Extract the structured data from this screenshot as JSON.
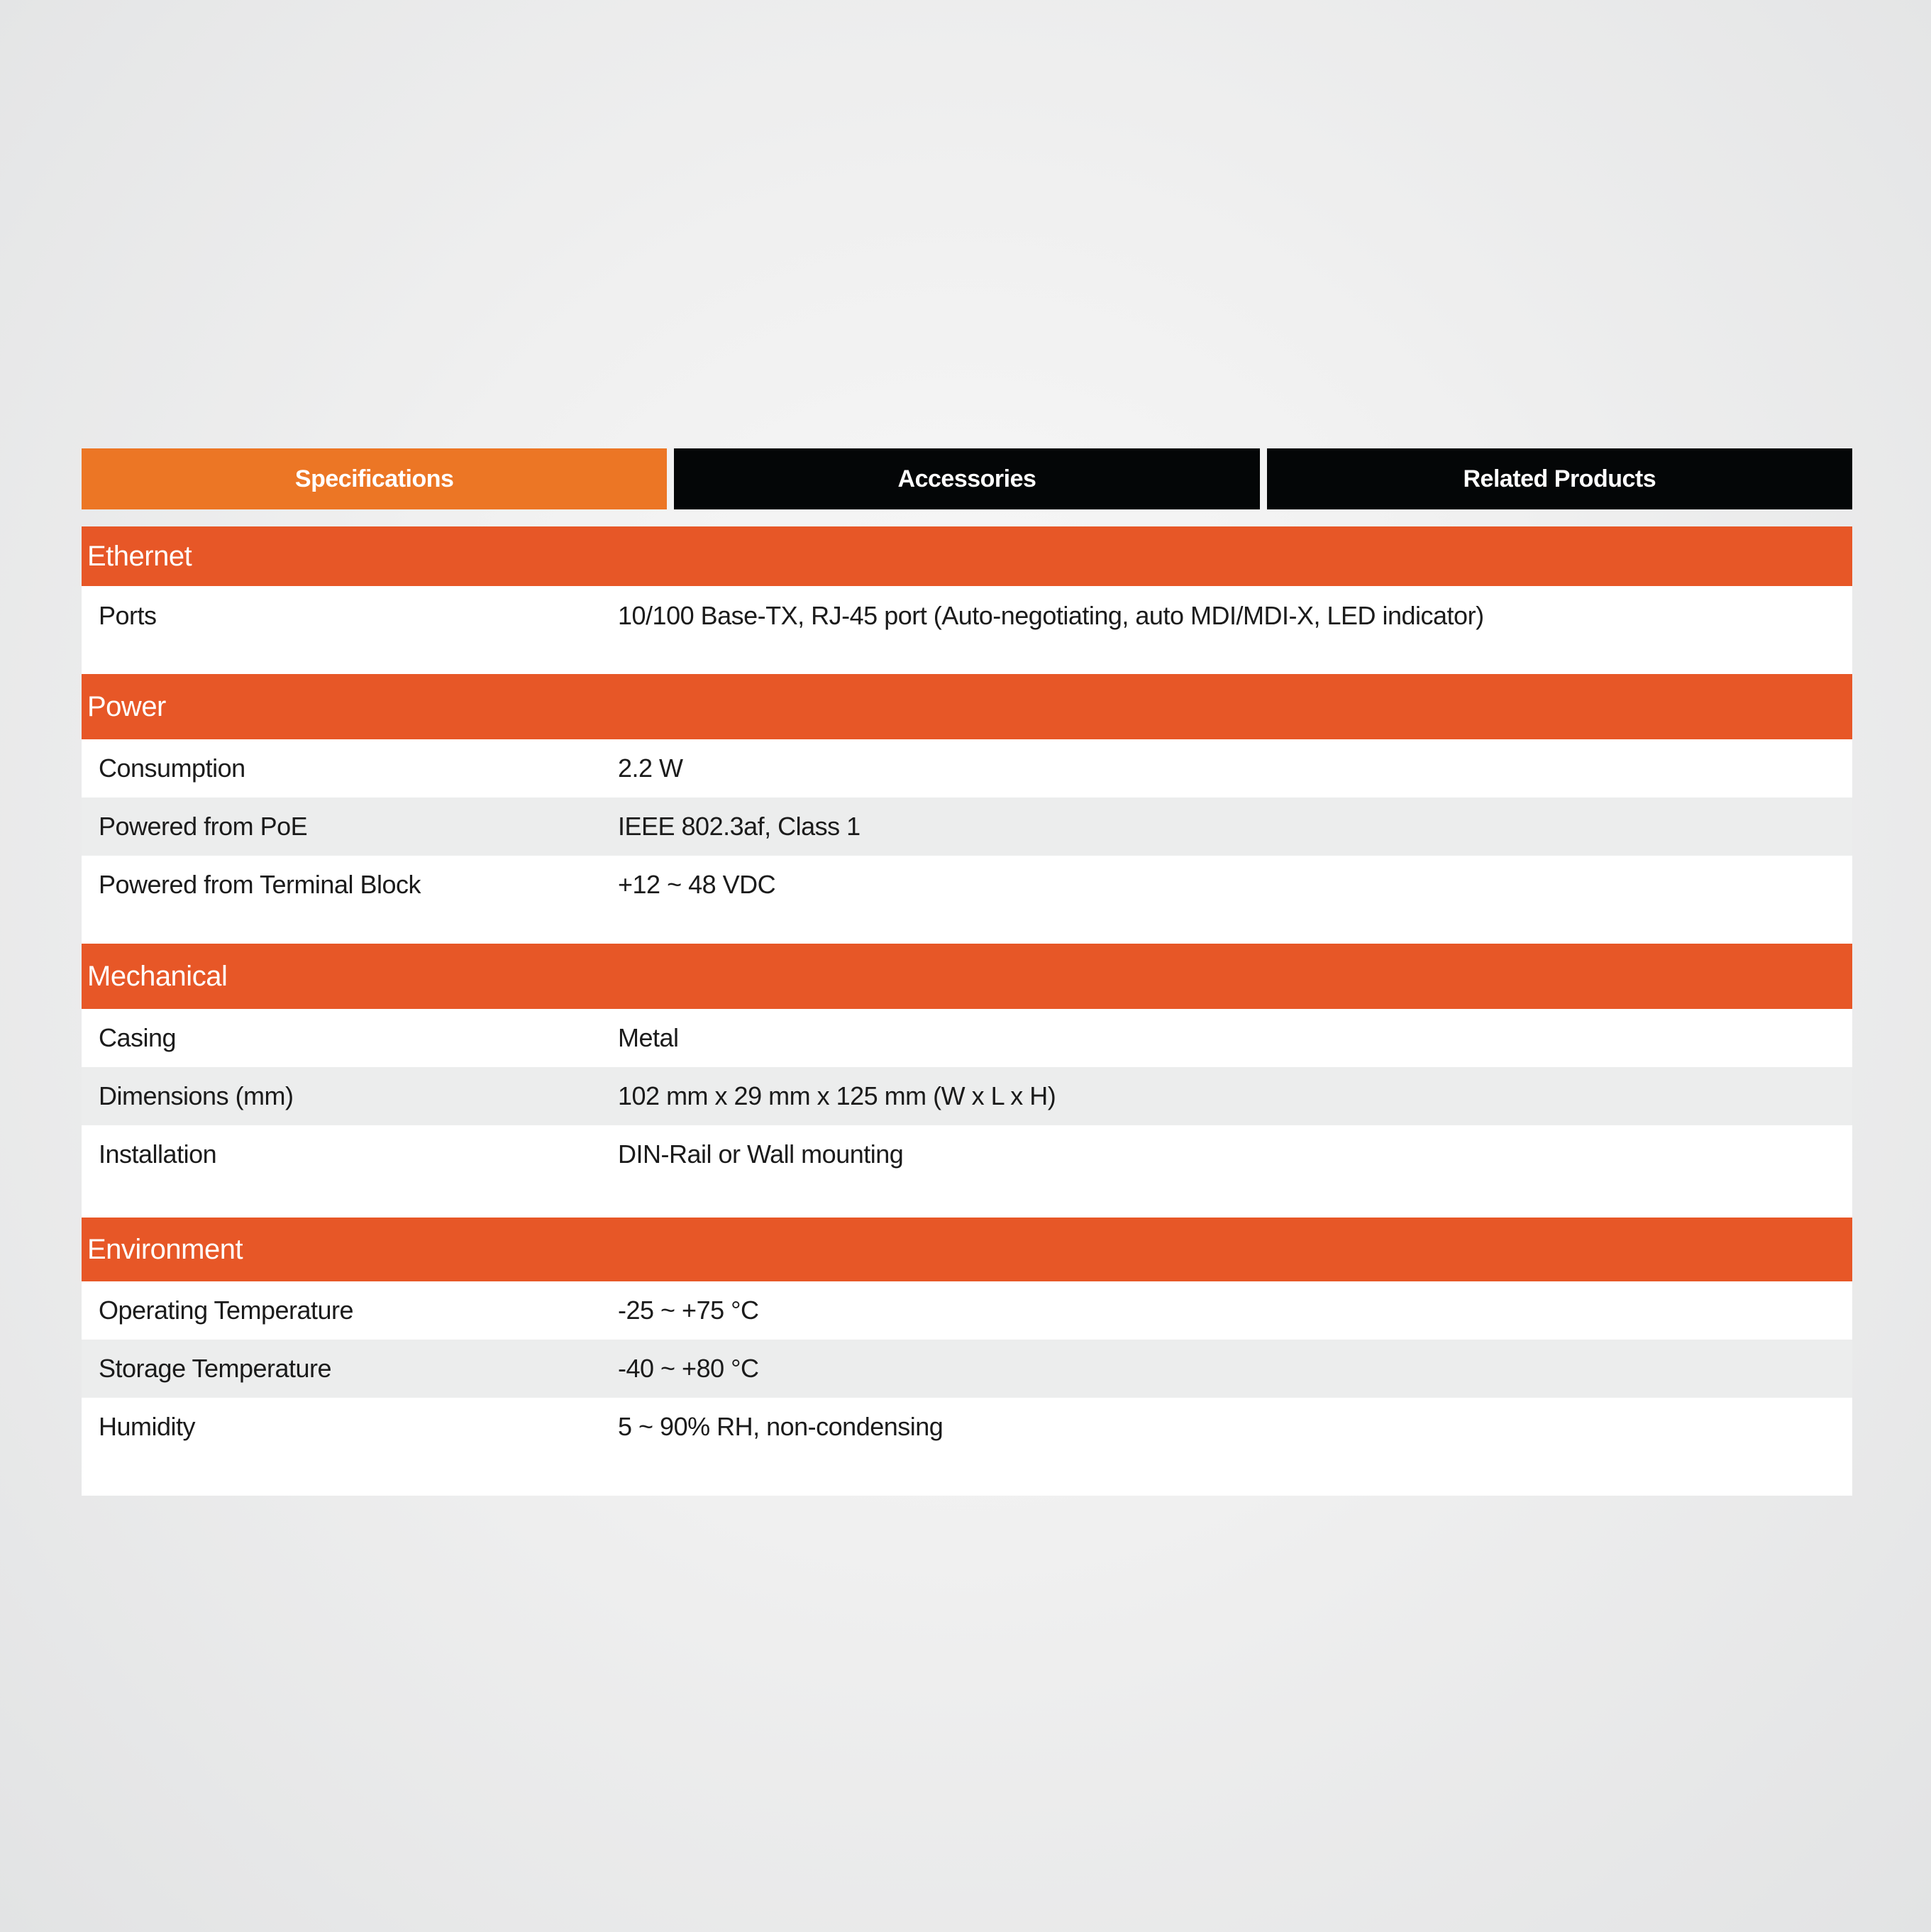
{
  "tabs": [
    {
      "label": "Specifications",
      "active": true
    },
    {
      "label": "Accessories",
      "active": false
    },
    {
      "label": "Related Products",
      "active": false
    }
  ],
  "colors": {
    "active_tab": "#ec7625",
    "inactive_tab": "#040607",
    "section_header": "#e75727",
    "alt_row": "#eceded"
  },
  "sections": [
    {
      "title": "Ethernet",
      "rows": [
        {
          "label": "Ports",
          "value": "10/100 Base-TX, RJ-45 port (Auto-negotiating, auto MDI/MDI-X, LED indicator)"
        }
      ]
    },
    {
      "title": "Power",
      "rows": [
        {
          "label": "Consumption",
          "value": "2.2 W"
        },
        {
          "label": "Powered from PoE",
          "value": "IEEE 802.3af, Class 1"
        },
        {
          "label": "Powered from Terminal Block",
          "value": "+12 ~ 48 VDC"
        }
      ]
    },
    {
      "title": "Mechanical",
      "rows": [
        {
          "label": "Casing",
          "value": "Metal"
        },
        {
          "label": "Dimensions (mm)",
          "value": "102 mm x 29 mm x 125 mm (W x L x H)"
        },
        {
          "label": "Installation",
          "value": "DIN-Rail or Wall mounting"
        }
      ]
    },
    {
      "title": "Environment",
      "rows": [
        {
          "label": "Operating Temperature",
          "value": "-25 ~ +75 °C"
        },
        {
          "label": "Storage Temperature",
          "value": "-40 ~ +80 °C"
        },
        {
          "label": "Humidity",
          "value": "5 ~ 90% RH, non-condensing"
        }
      ]
    }
  ]
}
